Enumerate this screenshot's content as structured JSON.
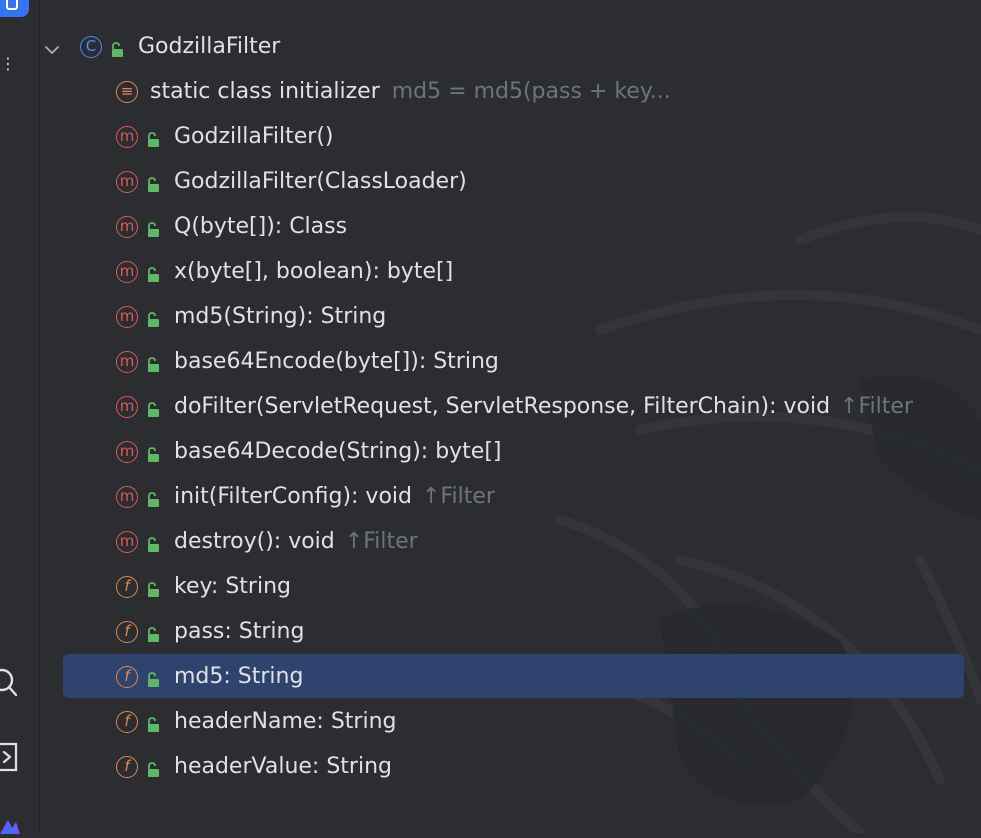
{
  "tree": {
    "root": {
      "kind": "C",
      "label": "GodzillaFilter",
      "lock_icon": "lock-open-icon"
    },
    "members": [
      {
        "kind": "≡",
        "label": "static class initializer",
        "hint": "md5 = md5(pass + key...",
        "inherit": ""
      },
      {
        "kind": "m",
        "label": "GodzillaFilter()",
        "hint": "",
        "inherit": ""
      },
      {
        "kind": "m",
        "label": "GodzillaFilter(ClassLoader)",
        "hint": "",
        "inherit": ""
      },
      {
        "kind": "m",
        "label": "Q(byte[]): Class",
        "hint": "",
        "inherit": ""
      },
      {
        "kind": "m",
        "label": "x(byte[], boolean): byte[]",
        "hint": "",
        "inherit": ""
      },
      {
        "kind": "m",
        "label": "md5(String): String",
        "hint": "",
        "inherit": ""
      },
      {
        "kind": "m",
        "label": "base64Encode(byte[]): String",
        "hint": "",
        "inherit": ""
      },
      {
        "kind": "m",
        "label": "doFilter(ServletRequest, ServletResponse, FilterChain): void",
        "hint": "",
        "inherit": "↑Filter"
      },
      {
        "kind": "m",
        "label": "base64Decode(String): byte[]",
        "hint": "",
        "inherit": ""
      },
      {
        "kind": "m",
        "label": "init(FilterConfig): void",
        "hint": "",
        "inherit": "↑Filter"
      },
      {
        "kind": "m",
        "label": "destroy(): void",
        "hint": "",
        "inherit": "↑Filter"
      },
      {
        "kind": "f",
        "label": "key: String",
        "hint": "",
        "inherit": ""
      },
      {
        "kind": "f",
        "label": "pass: String",
        "hint": "",
        "inherit": ""
      },
      {
        "kind": "f",
        "label": "md5: String",
        "hint": "",
        "inherit": "",
        "selected": true
      },
      {
        "kind": "f",
        "label": "headerName: String",
        "hint": "",
        "inherit": ""
      },
      {
        "kind": "f",
        "label": "headerValue: String",
        "hint": "",
        "inherit": ""
      }
    ]
  },
  "colors": {
    "background": "#2b2d30",
    "selection": "#2e436e",
    "class_icon": "#548af7",
    "method_icon": "#db5c5c",
    "field_icon": "#e08855",
    "lock_icon": "#5fb865",
    "hint_text": "#6f737a"
  },
  "sidebar": {
    "icons": [
      "structure-tool-icon",
      "more-icon",
      "search-icon",
      "run-icon",
      "product-logo-icon"
    ]
  }
}
